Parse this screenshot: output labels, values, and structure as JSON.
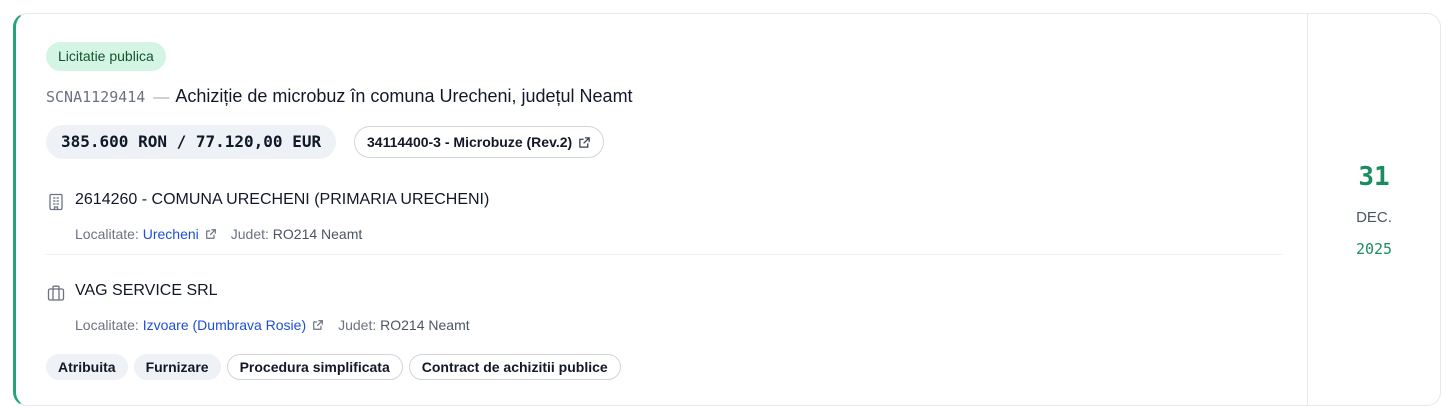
{
  "status_badge": "Licitatie publica",
  "notice": {
    "code": "SCNA1129414",
    "separator": "—",
    "title": "Achiziție de microbuz în comuna Urecheni, județul Neamt"
  },
  "value": "385.600 RON / 77.120,00 EUR",
  "cpv": "34114400-3 - Microbuze (Rev.2)",
  "authority": {
    "name": "2614260 - COMUNA URECHENI (PRIMARIA URECHENI)",
    "localitate_label": "Localitate:",
    "localitate": "Urecheni",
    "judet_label": "Judet:",
    "judet": "RO214 Neamt",
    "icon": "building-icon"
  },
  "supplier": {
    "name": "VAG SERVICE SRL",
    "localitate_label": "Localitate:",
    "localitate": "Izvoare (Dumbrava Rosie)",
    "judet_label": "Judet:",
    "judet": "RO214 Neamt",
    "icon": "briefcase-icon"
  },
  "tags": {
    "t0": "Atribuita",
    "t1": "Furnizare",
    "t2": "Procedura simplificata",
    "t3": "Contract de achizitii publice"
  },
  "date": {
    "day": "31",
    "month": "DEC.",
    "year": "2025"
  },
  "colors": {
    "accent": "#22a37a",
    "date_green": "#1a8d5f",
    "badge_bg": "#d4f5e4",
    "link": "#1d4ed8"
  }
}
